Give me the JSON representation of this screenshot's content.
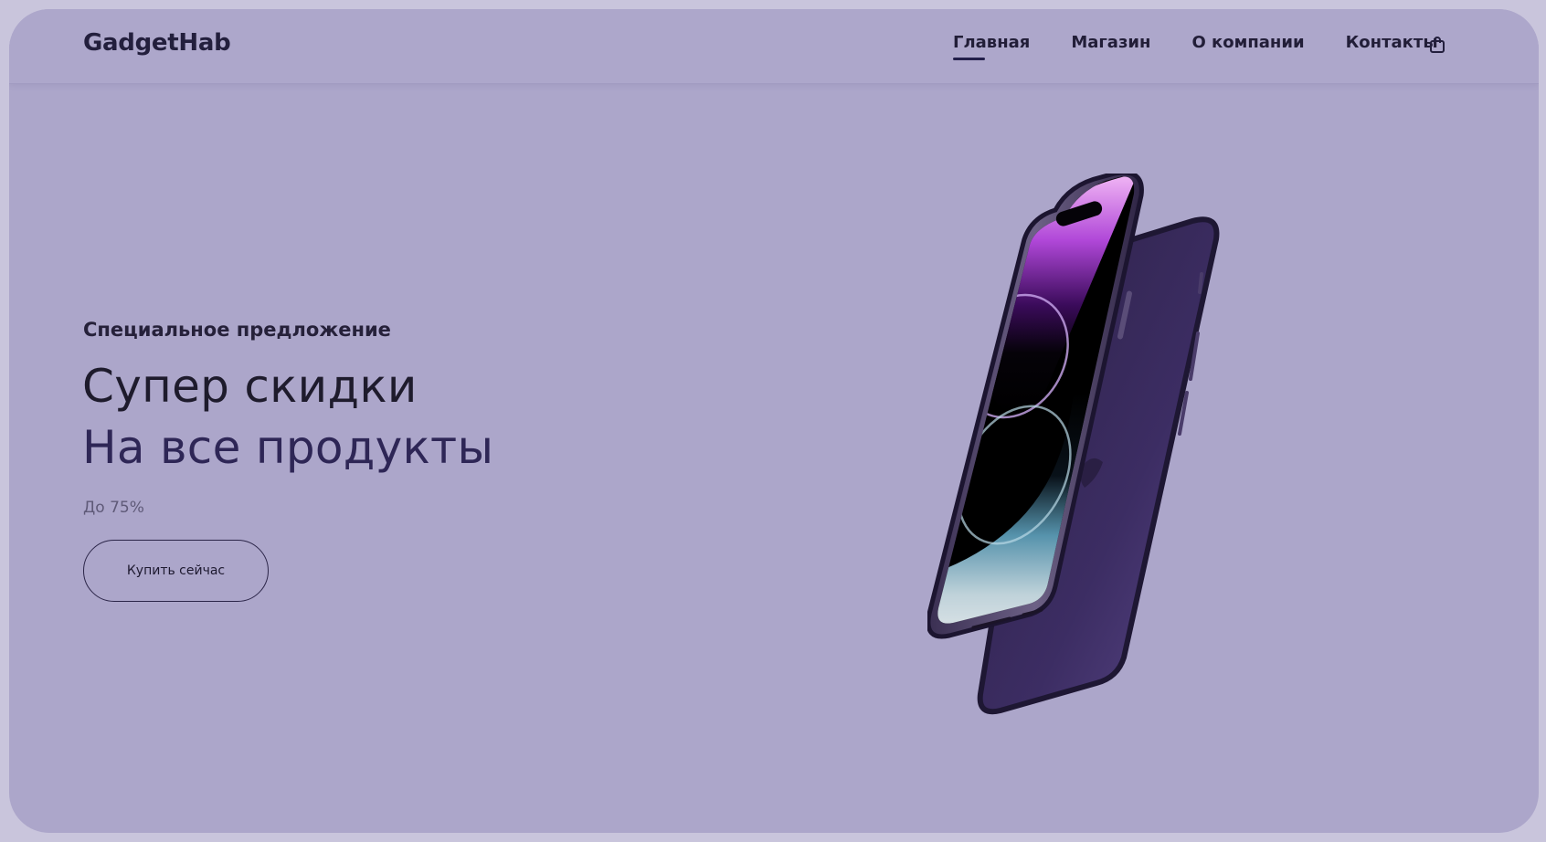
{
  "brand": {
    "logo": "GadgetHab"
  },
  "nav": {
    "items": [
      {
        "label": "Главная",
        "active": true
      },
      {
        "label": "Магазин",
        "active": false
      },
      {
        "label": "О компании",
        "active": false
      },
      {
        "label": "Контакты",
        "active": false
      }
    ],
    "cart_icon": "shopping-bag-icon"
  },
  "hero": {
    "eyebrow": "Специальное предложение",
    "title_line1": "Супер скидки",
    "title_line2": "На все продукты",
    "discount": "До 75%",
    "cta_label": "Купить сейчас",
    "image": "smartphone-product-image"
  },
  "colors": {
    "background": "#aca6ca",
    "text_dark": "#1e1b2c",
    "accent": "#2e2656"
  }
}
